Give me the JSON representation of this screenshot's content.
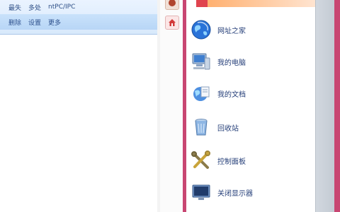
{
  "left_panel": {
    "row1": [
      "最失",
      "多处",
      "ntPC/IPC"
    ],
    "row2": [
      "删除",
      "设置",
      "更多"
    ]
  },
  "menu": {
    "items": [
      {
        "label": "网址之家",
        "icon": "globe-icon"
      },
      {
        "label": "我的电脑",
        "icon": "computer-icon"
      },
      {
        "label": "我的文档",
        "icon": "documents-icon"
      },
      {
        "label": "回收站",
        "icon": "recycle-bin-icon"
      },
      {
        "label": "控制面板",
        "icon": "tools-icon"
      },
      {
        "label": "关闭显示器",
        "icon": "monitor-icon"
      }
    ]
  },
  "colors": {
    "frame_pink": "#c84672",
    "accent_blue": "#2d4e86"
  }
}
